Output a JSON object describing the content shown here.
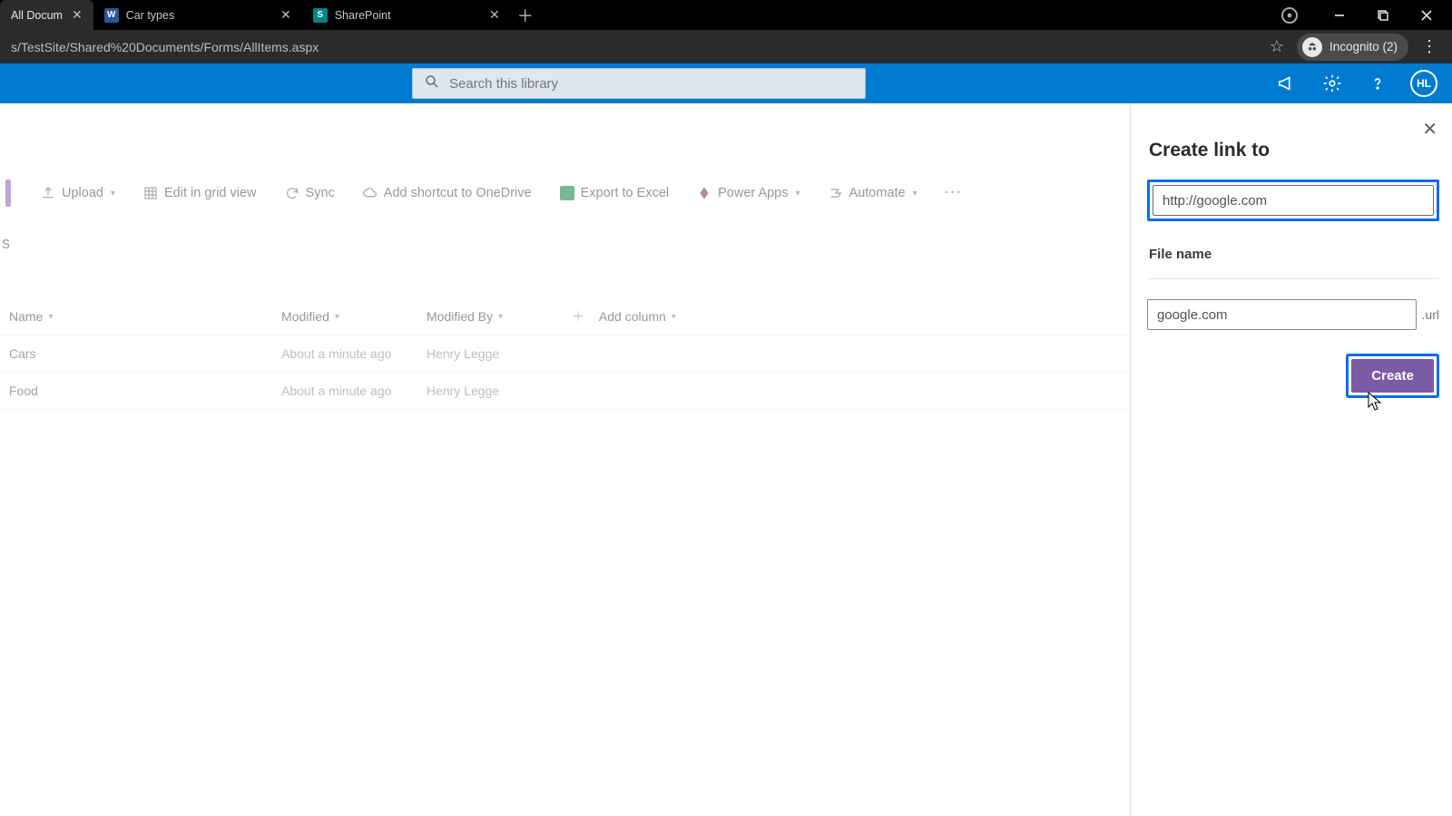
{
  "browser": {
    "tabs": [
      {
        "title": "All Docum",
        "active": true
      },
      {
        "title": "Car types",
        "active": false,
        "app": "word"
      },
      {
        "title": "SharePoint",
        "active": false,
        "app": "sharepoint"
      }
    ],
    "url": "s/TestSite/Shared%20Documents/Forms/AllItems.aspx",
    "incognito_label": "Incognito (2)"
  },
  "suite": {
    "search_placeholder": "Search this library",
    "avatar_initials": "HL"
  },
  "commandbar": {
    "upload": "Upload",
    "edit_grid": "Edit in grid view",
    "sync": "Sync",
    "add_shortcut": "Add shortcut to OneDrive",
    "export_excel": "Export to Excel",
    "power_apps": "Power Apps",
    "automate": "Automate"
  },
  "library": {
    "letter_stub": "s",
    "columns": {
      "name": "Name",
      "modified": "Modified",
      "modified_by": "Modified By",
      "add_column": "Add column"
    },
    "rows": [
      {
        "name": "Cars",
        "modified": "About a minute ago",
        "modified_by": "Henry Legge"
      },
      {
        "name": "Food",
        "modified": "About a minute ago",
        "modified_by": "Henry Legge"
      }
    ]
  },
  "panel": {
    "title": "Create link to",
    "link_value": "http://google.com",
    "file_name_label": "File name",
    "file_name_value": "google.com",
    "file_ext": ".url",
    "create_label": "Create"
  }
}
